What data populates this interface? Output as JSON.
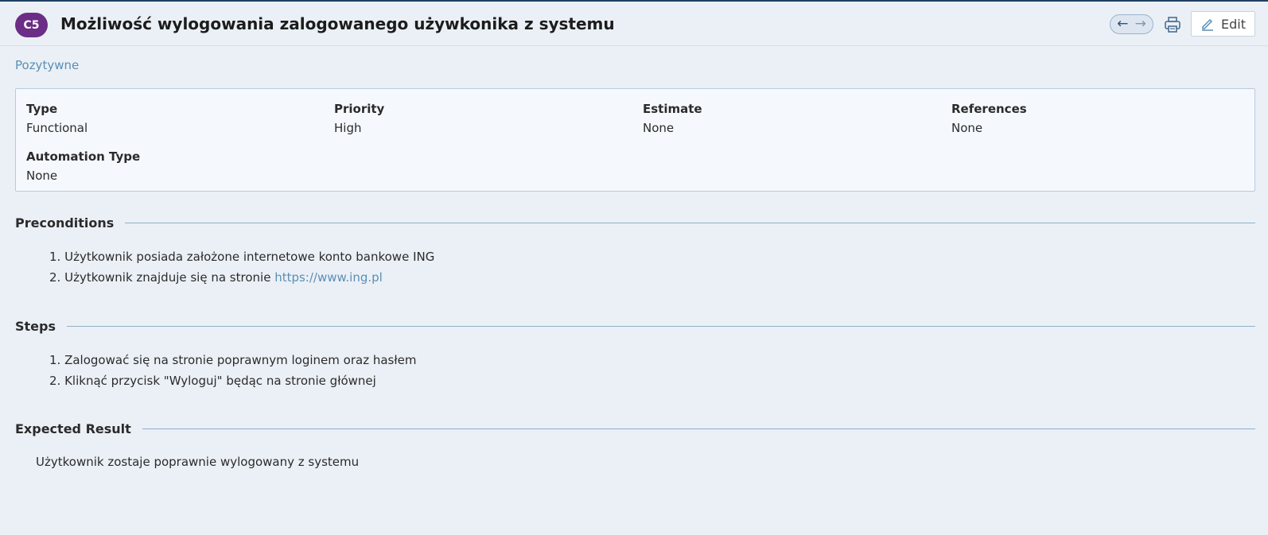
{
  "header": {
    "case_id": "C5",
    "title": "Możliwość wylogowania zalogowanego używkonika z systemu",
    "nav_prev_icon": "arrow-left-icon",
    "nav_next_icon": "arrow-right-icon",
    "print_icon": "printer-icon",
    "edit_label": "Edit",
    "badge_color": "#6b2d86"
  },
  "section": "Pozytywne",
  "fields": {
    "type": {
      "label": "Type",
      "value": "Functional"
    },
    "priority": {
      "label": "Priority",
      "value": "High"
    },
    "estimate": {
      "label": "Estimate",
      "value": "None"
    },
    "references": {
      "label": "References",
      "value": "None"
    },
    "automation_type": {
      "label": "Automation Type",
      "value": "None"
    }
  },
  "preconditions": {
    "heading": "Preconditions",
    "items": [
      {
        "num": "1.",
        "text": "Użytkownik posiada założone internetowe konto bankowe ING"
      },
      {
        "num": "2.",
        "text": "Użytkownik znajduje się na stronie ",
        "link": "https://www.ing.pl"
      }
    ]
  },
  "steps": {
    "heading": "Steps",
    "items": [
      {
        "num": "1.",
        "text": "Zalogować się na stronie poprawnym loginem oraz hasłem"
      },
      {
        "num": "2.",
        "text": "Kliknąć przycisk \"Wyloguj\" będąc na stronie głównej"
      }
    ]
  },
  "expected_result": {
    "heading": "Expected Result",
    "text": "Użytkownik zostaje poprawnie wylogowany z systemu"
  }
}
